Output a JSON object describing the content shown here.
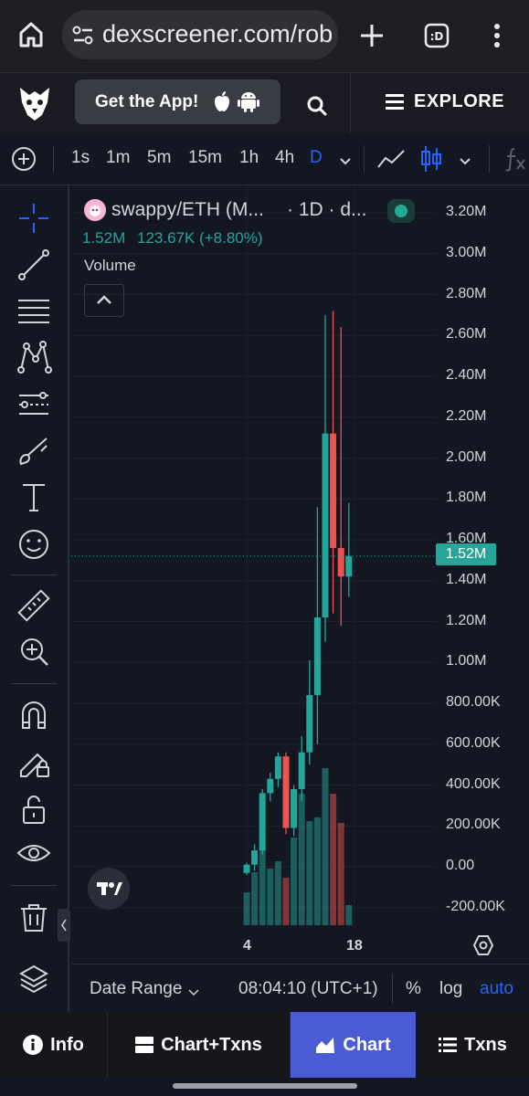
{
  "browser": {
    "url": "dexscreener.com/rob"
  },
  "header": {
    "get_app_label": "Get the App!",
    "explore_label": "EXPLORE"
  },
  "toolbar": {
    "timeframes": [
      "1s",
      "1m",
      "5m",
      "15m",
      "1h",
      "4h",
      "D"
    ],
    "active_timeframe": "D"
  },
  "legend": {
    "symbol": "swappy/ETH (M...",
    "interval": "· 1D · d...",
    "price": "1.52M",
    "change": "123.67K (+8.80%)",
    "volume_label": "Volume"
  },
  "price_axis": {
    "ticks": [
      "3.20M",
      "3.00M",
      "2.80M",
      "2.60M",
      "2.40M",
      "2.20M",
      "2.00M",
      "1.80M",
      "1.60M",
      "1.40M",
      "1.20M",
      "1.00M",
      "800.00K",
      "600.00K",
      "400.00K",
      "200.00K",
      "0.00",
      "-200.00K"
    ],
    "current_price": "1.52M"
  },
  "time_axis": {
    "labels": [
      "4",
      "18"
    ]
  },
  "bottom_bar": {
    "date_range": "Date Range",
    "time": "08:04:10 (UTC+1)",
    "percent": "%",
    "log": "log",
    "auto": "auto"
  },
  "tabs": {
    "info": "Info",
    "chart_txns": "Chart+Txns",
    "chart": "Chart",
    "txns": "Txns"
  },
  "colors": {
    "up": "#26a69a",
    "down": "#ef5350",
    "accent": "#2962ff",
    "active_tab": "#4a5bd4"
  },
  "chart_data": {
    "type": "candlestick",
    "price_unit": "market cap",
    "candles": [
      {
        "o": -30000,
        "h": 20000,
        "l": -40000,
        "c": 10000
      },
      {
        "o": 10000,
        "h": 110000,
        "l": -20000,
        "c": 80000
      },
      {
        "o": 80000,
        "h": 380000,
        "l": 60000,
        "c": 360000
      },
      {
        "o": 360000,
        "h": 460000,
        "l": 320000,
        "c": 430000
      },
      {
        "o": 430000,
        "h": 560000,
        "l": 390000,
        "c": 540000
      },
      {
        "o": 540000,
        "h": 560000,
        "l": 160000,
        "c": 190000
      },
      {
        "o": 190000,
        "h": 400000,
        "l": 150000,
        "c": 380000
      },
      {
        "o": 380000,
        "h": 640000,
        "l": 320000,
        "c": 560000
      },
      {
        "o": 560000,
        "h": 1010000,
        "l": 500000,
        "c": 840000
      },
      {
        "o": 840000,
        "h": 1760000,
        "l": 600000,
        "c": 1220000
      },
      {
        "o": 1220000,
        "h": 2700000,
        "l": 1100000,
        "c": 2120000
      },
      {
        "o": 2120000,
        "h": 2720000,
        "l": 1240000,
        "c": 1560000
      },
      {
        "o": 1560000,
        "h": 2640000,
        "l": 1180000,
        "c": 1420000
      },
      {
        "o": 1420000,
        "h": 1780000,
        "l": 1320000,
        "c": 1520000
      }
    ],
    "volume_relative": [
      0.18,
      0.29,
      0.42,
      0.31,
      0.35,
      0.26,
      0.48,
      0.72,
      0.57,
      0.59,
      0.86,
      0.72,
      0.56,
      0.11
    ]
  }
}
